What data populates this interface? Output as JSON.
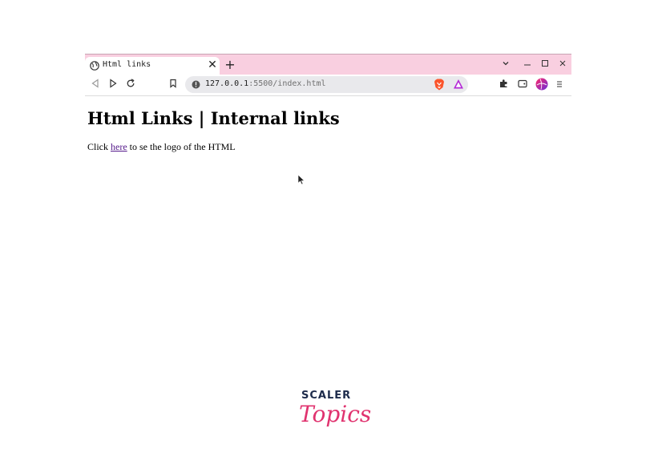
{
  "browser": {
    "tab": {
      "title": "Html links",
      "favicon": "globe-icon",
      "close_label": "✕"
    },
    "new_tab_label": "+",
    "window_controls": {
      "dropdown": "⌄",
      "minimize": "—",
      "maximize": "☐",
      "close": "✕"
    },
    "toolbar": {
      "back": "back-icon",
      "forward": "forward-icon",
      "reload": "reload-icon",
      "bookmark": "bookmark-icon",
      "url_host": "127.0.0.1",
      "url_rest": ":5500/index.html",
      "extensions": "puzzle-icon",
      "wallet": "wallet-icon",
      "profile": "profile-icon",
      "menu": "menu-icon"
    },
    "colors": {
      "tabstrip": "#f9cfe0",
      "urlbar": "#e9e9ec",
      "link": "#551a8b",
      "logo_pink": "#e0336f",
      "logo_navy": "#1d2b4b"
    }
  },
  "page": {
    "heading": "Html Links | Internal links",
    "para_before": "Click ",
    "link_text": "here",
    "para_after": " to se the logo of the HTML"
  },
  "logo": {
    "top": "SCALER",
    "bottom": "Topics"
  }
}
